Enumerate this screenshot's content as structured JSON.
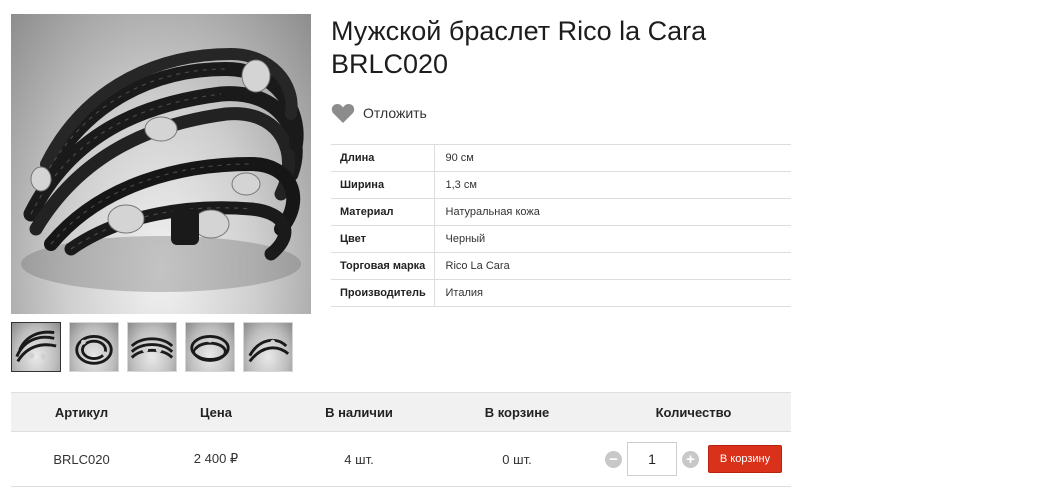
{
  "product": {
    "title": "Мужской браслет Rico la Cara BRLC020",
    "wishlist_label": "Отложить",
    "images": [
      {
        "name": "main-photo",
        "alt": "bracelet"
      }
    ],
    "thumbnails": [
      "thumb-1",
      "thumb-2",
      "thumb-3",
      "thumb-4",
      "thumb-5"
    ]
  },
  "properties": [
    {
      "name": "Длина",
      "value": "90 см"
    },
    {
      "name": "Ширина",
      "value": "1,3 см"
    },
    {
      "name": "Материал",
      "value": "Натуральная кожа"
    },
    {
      "name": "Цвет",
      "value": "Черный"
    },
    {
      "name": "Торговая марка",
      "value": "Rico La Cara"
    },
    {
      "name": "Производитель",
      "value": "Италия"
    }
  ],
  "offers": {
    "headers": {
      "article": "Артикул",
      "price": "Цена",
      "stock": "В наличии",
      "in_cart": "В корзине",
      "quantity": "Количество"
    },
    "row": {
      "article": "BRLC020",
      "price": "2 400 ₽",
      "stock": "4 шт.",
      "in_cart": "0 шт.",
      "quantity": "1",
      "minus": "−",
      "plus": "+",
      "button": "В корзину"
    }
  },
  "colors": {
    "accent": "#d9311a",
    "heart": "#8c8c8c",
    "header_bg": "#f1f1f1"
  },
  "icons": {
    "wishlist": "heart-icon",
    "minus": "minus-icon",
    "plus": "plus-icon"
  }
}
